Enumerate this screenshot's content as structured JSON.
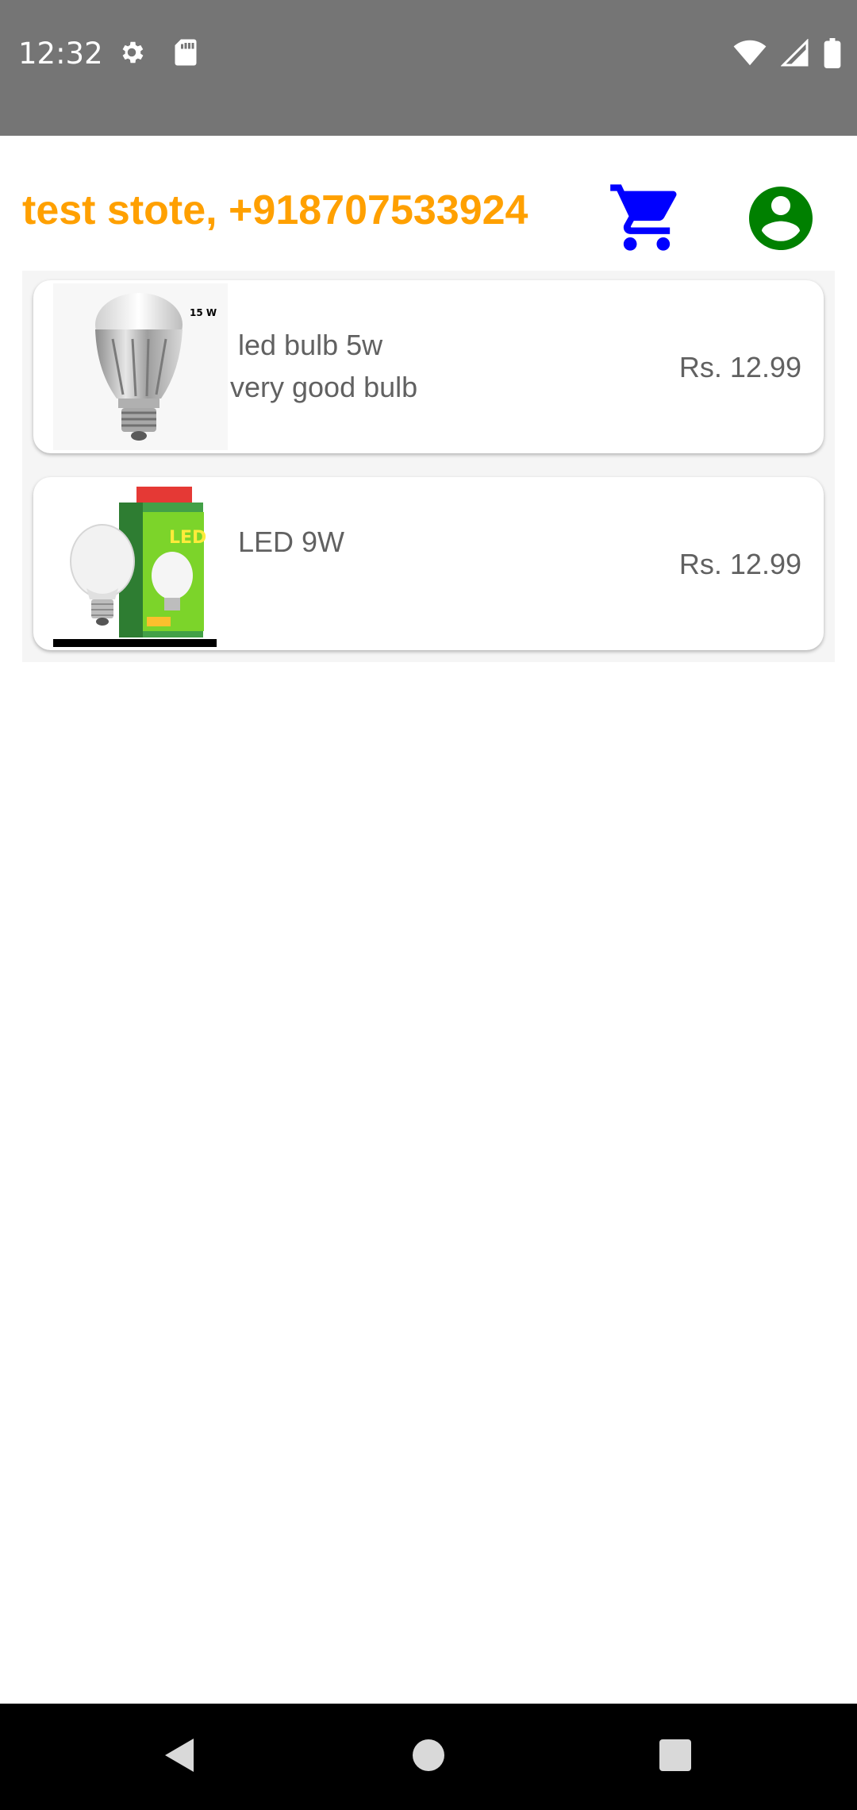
{
  "status_bar": {
    "time": "12:32",
    "left_icons": [
      "gear-icon",
      "sd-card-icon"
    ],
    "right_icons": [
      "wifi-icon",
      "cell-signal-icon",
      "battery-icon"
    ]
  },
  "header": {
    "store_title": "test stote, +918707533924",
    "title_color": "#FFA000",
    "cart_icon": "cart-icon",
    "cart_color": "#0000FF",
    "profile_icon": "account-circle-icon",
    "profile_color": "#008000"
  },
  "products": [
    {
      "name": "led bulb 5w",
      "description": "very good bulb",
      "price": "Rs. 12.99",
      "image_label": "15 W"
    },
    {
      "name": "LED 9W",
      "description": "",
      "price": "Rs. 12.99",
      "image_label": "LED"
    }
  ],
  "nav_bar": {
    "buttons": [
      "back-icon",
      "home-icon",
      "recents-icon"
    ]
  }
}
